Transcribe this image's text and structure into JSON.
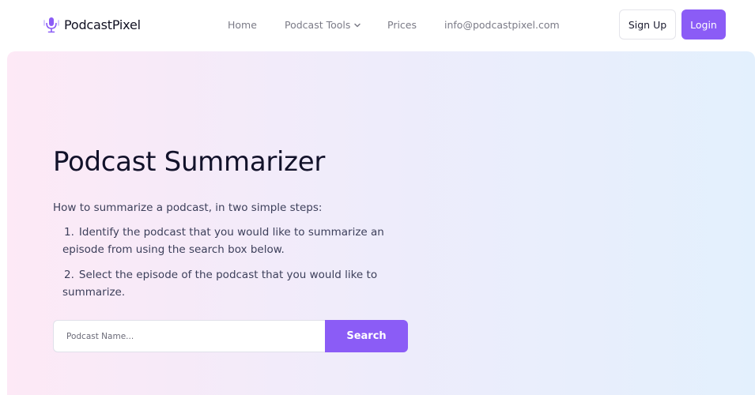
{
  "brand": {
    "name": "PodcastPixel",
    "icon": "podcast-microphone-icon",
    "accent_color": "#8b5cf6"
  },
  "nav": {
    "home": "Home",
    "podcast_tools": "Podcast Tools",
    "prices": "Prices",
    "email": "info@podcastpixel.com"
  },
  "auth": {
    "sign_up": "Sign Up",
    "login": "Login"
  },
  "hero": {
    "title": "Podcast Summarizer",
    "intro": "How to summarize a podcast, in two simple steps:",
    "steps": [
      {
        "number": "1.",
        "text": "Identify the podcast that you would like to summarize an episode from using the search box below."
      },
      {
        "number": "2.",
        "text": "Select the episode of the podcast that you would like to summarize."
      }
    ]
  },
  "search": {
    "placeholder": "Podcast Name...",
    "value": "",
    "button_label": "Search"
  }
}
